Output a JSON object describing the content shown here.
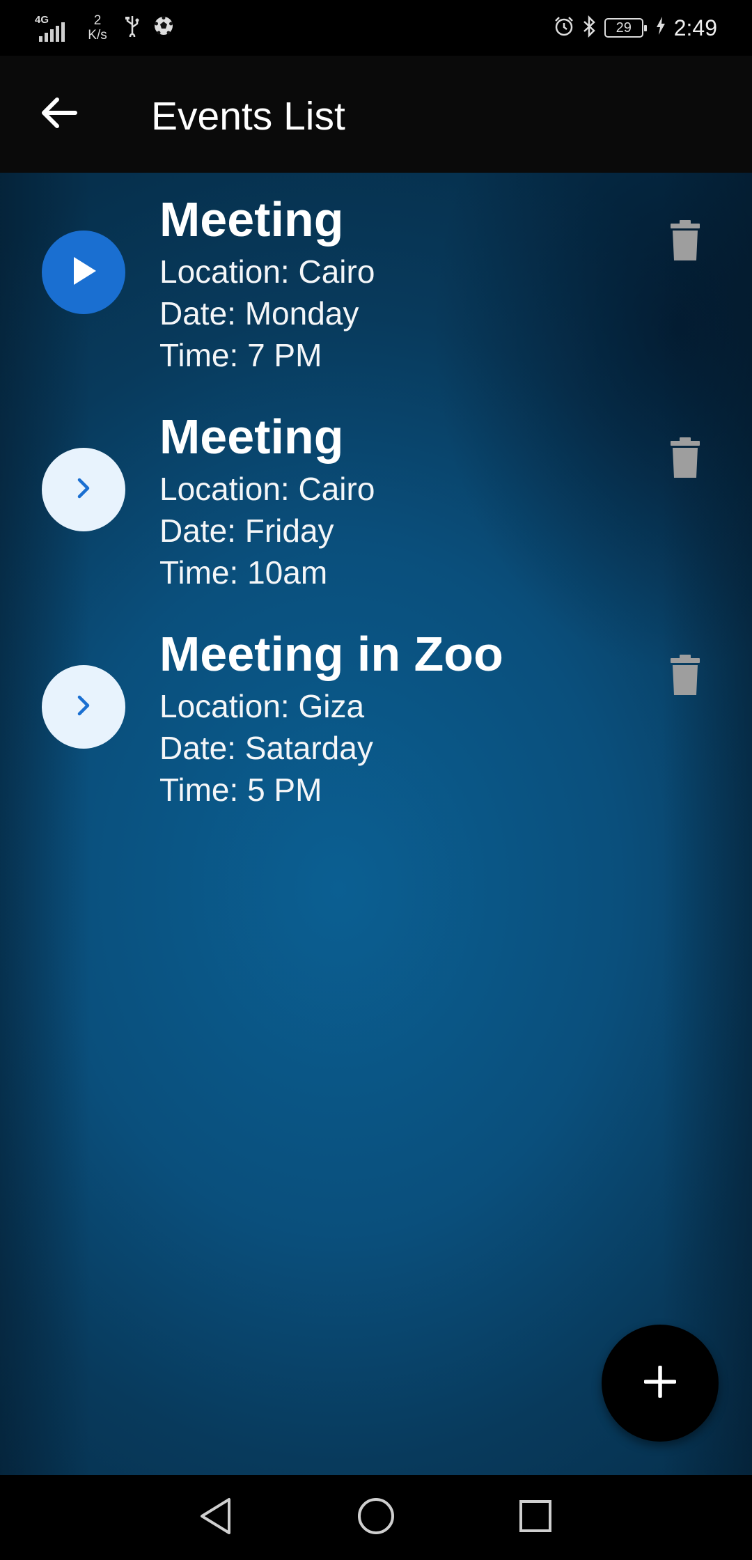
{
  "status_bar": {
    "network": "4G",
    "speed_value": "2",
    "speed_unit": "K/s",
    "battery": "29",
    "time": "2:49"
  },
  "app_bar": {
    "title": "Events List"
  },
  "events": [
    {
      "title": "Meeting",
      "location": "Location: Cairo",
      "date": "Date: Monday",
      "time": "Time: 7 PM",
      "action_state": "active"
    },
    {
      "title": "Meeting",
      "location": "Location: Cairo",
      "date": "Date: Friday",
      "time": "Time: 10am",
      "action_state": "inactive"
    },
    {
      "title": "Meeting in Zoo",
      "location": "Location: Giza",
      "date": "Date: Satarday",
      "time": "Time: 5 PM",
      "action_state": "inactive"
    }
  ],
  "colors": {
    "active_button": "#1a6fd1",
    "inactive_button": "#e8f3fd",
    "delete_icon": "#9e9e9e",
    "fab_background": "#000000"
  },
  "icons": {
    "back": "arrow-left-icon",
    "play": "play-icon",
    "chevron": "chevron-right-icon",
    "delete": "trash-icon",
    "add": "plus-icon",
    "nav_back": "triangle-back-icon",
    "nav_home": "circle-home-icon",
    "nav_recents": "square-recents-icon"
  }
}
